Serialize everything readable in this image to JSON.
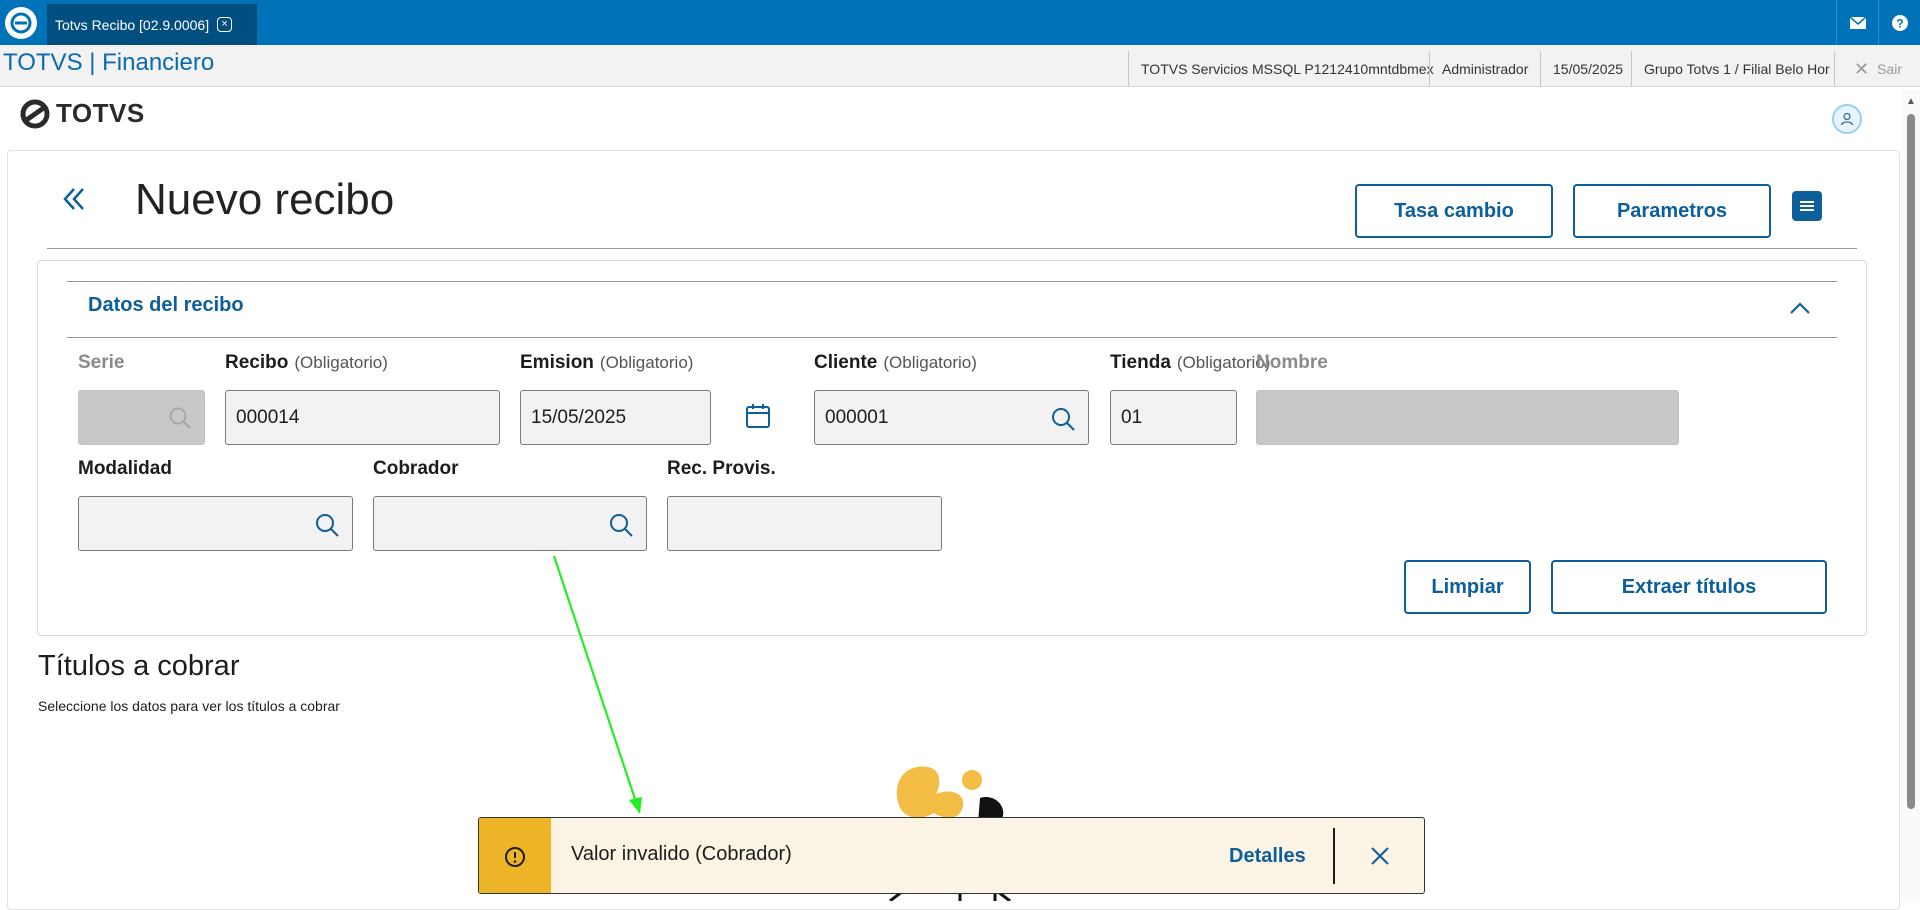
{
  "window": {
    "tab_title": "Totvs Recibo [02.9.0006]"
  },
  "header": {
    "app_title": "TOTVS | Financiero",
    "environment": "TOTVS Servicios MSSQL P1212410mntdbmex",
    "user": "Administrador",
    "date": "15/05/2025",
    "branch": "Grupo Totvs 1 / Filial Belo Hor",
    "exit_label": "Sair"
  },
  "brand": {
    "name": "TOTVS"
  },
  "page": {
    "title": "Nuevo recibo",
    "buttons": {
      "exchange_rate": "Tasa cambio",
      "parameters": "Parametros"
    }
  },
  "form": {
    "section_title": "Datos del recibo",
    "optional_hint": "(Obligatorio)",
    "fields": {
      "serie": {
        "label": "Serie",
        "value": ""
      },
      "recibo": {
        "label": "Recibo",
        "value": "000014"
      },
      "emision": {
        "label": "Emision",
        "value": "15/05/2025"
      },
      "cliente": {
        "label": "Cliente",
        "value": "000001"
      },
      "tienda": {
        "label": "Tienda",
        "value": "01"
      },
      "nombre": {
        "label": "Nombre",
        "value": ""
      },
      "modalidad": {
        "label": "Modalidad",
        "value": ""
      },
      "cobrador": {
        "label": "Cobrador",
        "value": ""
      },
      "rec_provis": {
        "label": "Rec. Provis.",
        "value": ""
      }
    },
    "buttons": {
      "clear": "Limpiar",
      "extract": "Extraer títulos"
    }
  },
  "titles_section": {
    "title": "Títulos a cobrar",
    "subtitle": "Seleccione los datos para ver los títulos a cobrar"
  },
  "toast": {
    "message": "Valor invalido (Cobrador)",
    "details_label": "Detalles"
  },
  "colors": {
    "topbar": "#0072b8",
    "accent": "#0c5f9a",
    "toast_warning": "#ecb426",
    "annotation_arrow": "#22ee22"
  }
}
